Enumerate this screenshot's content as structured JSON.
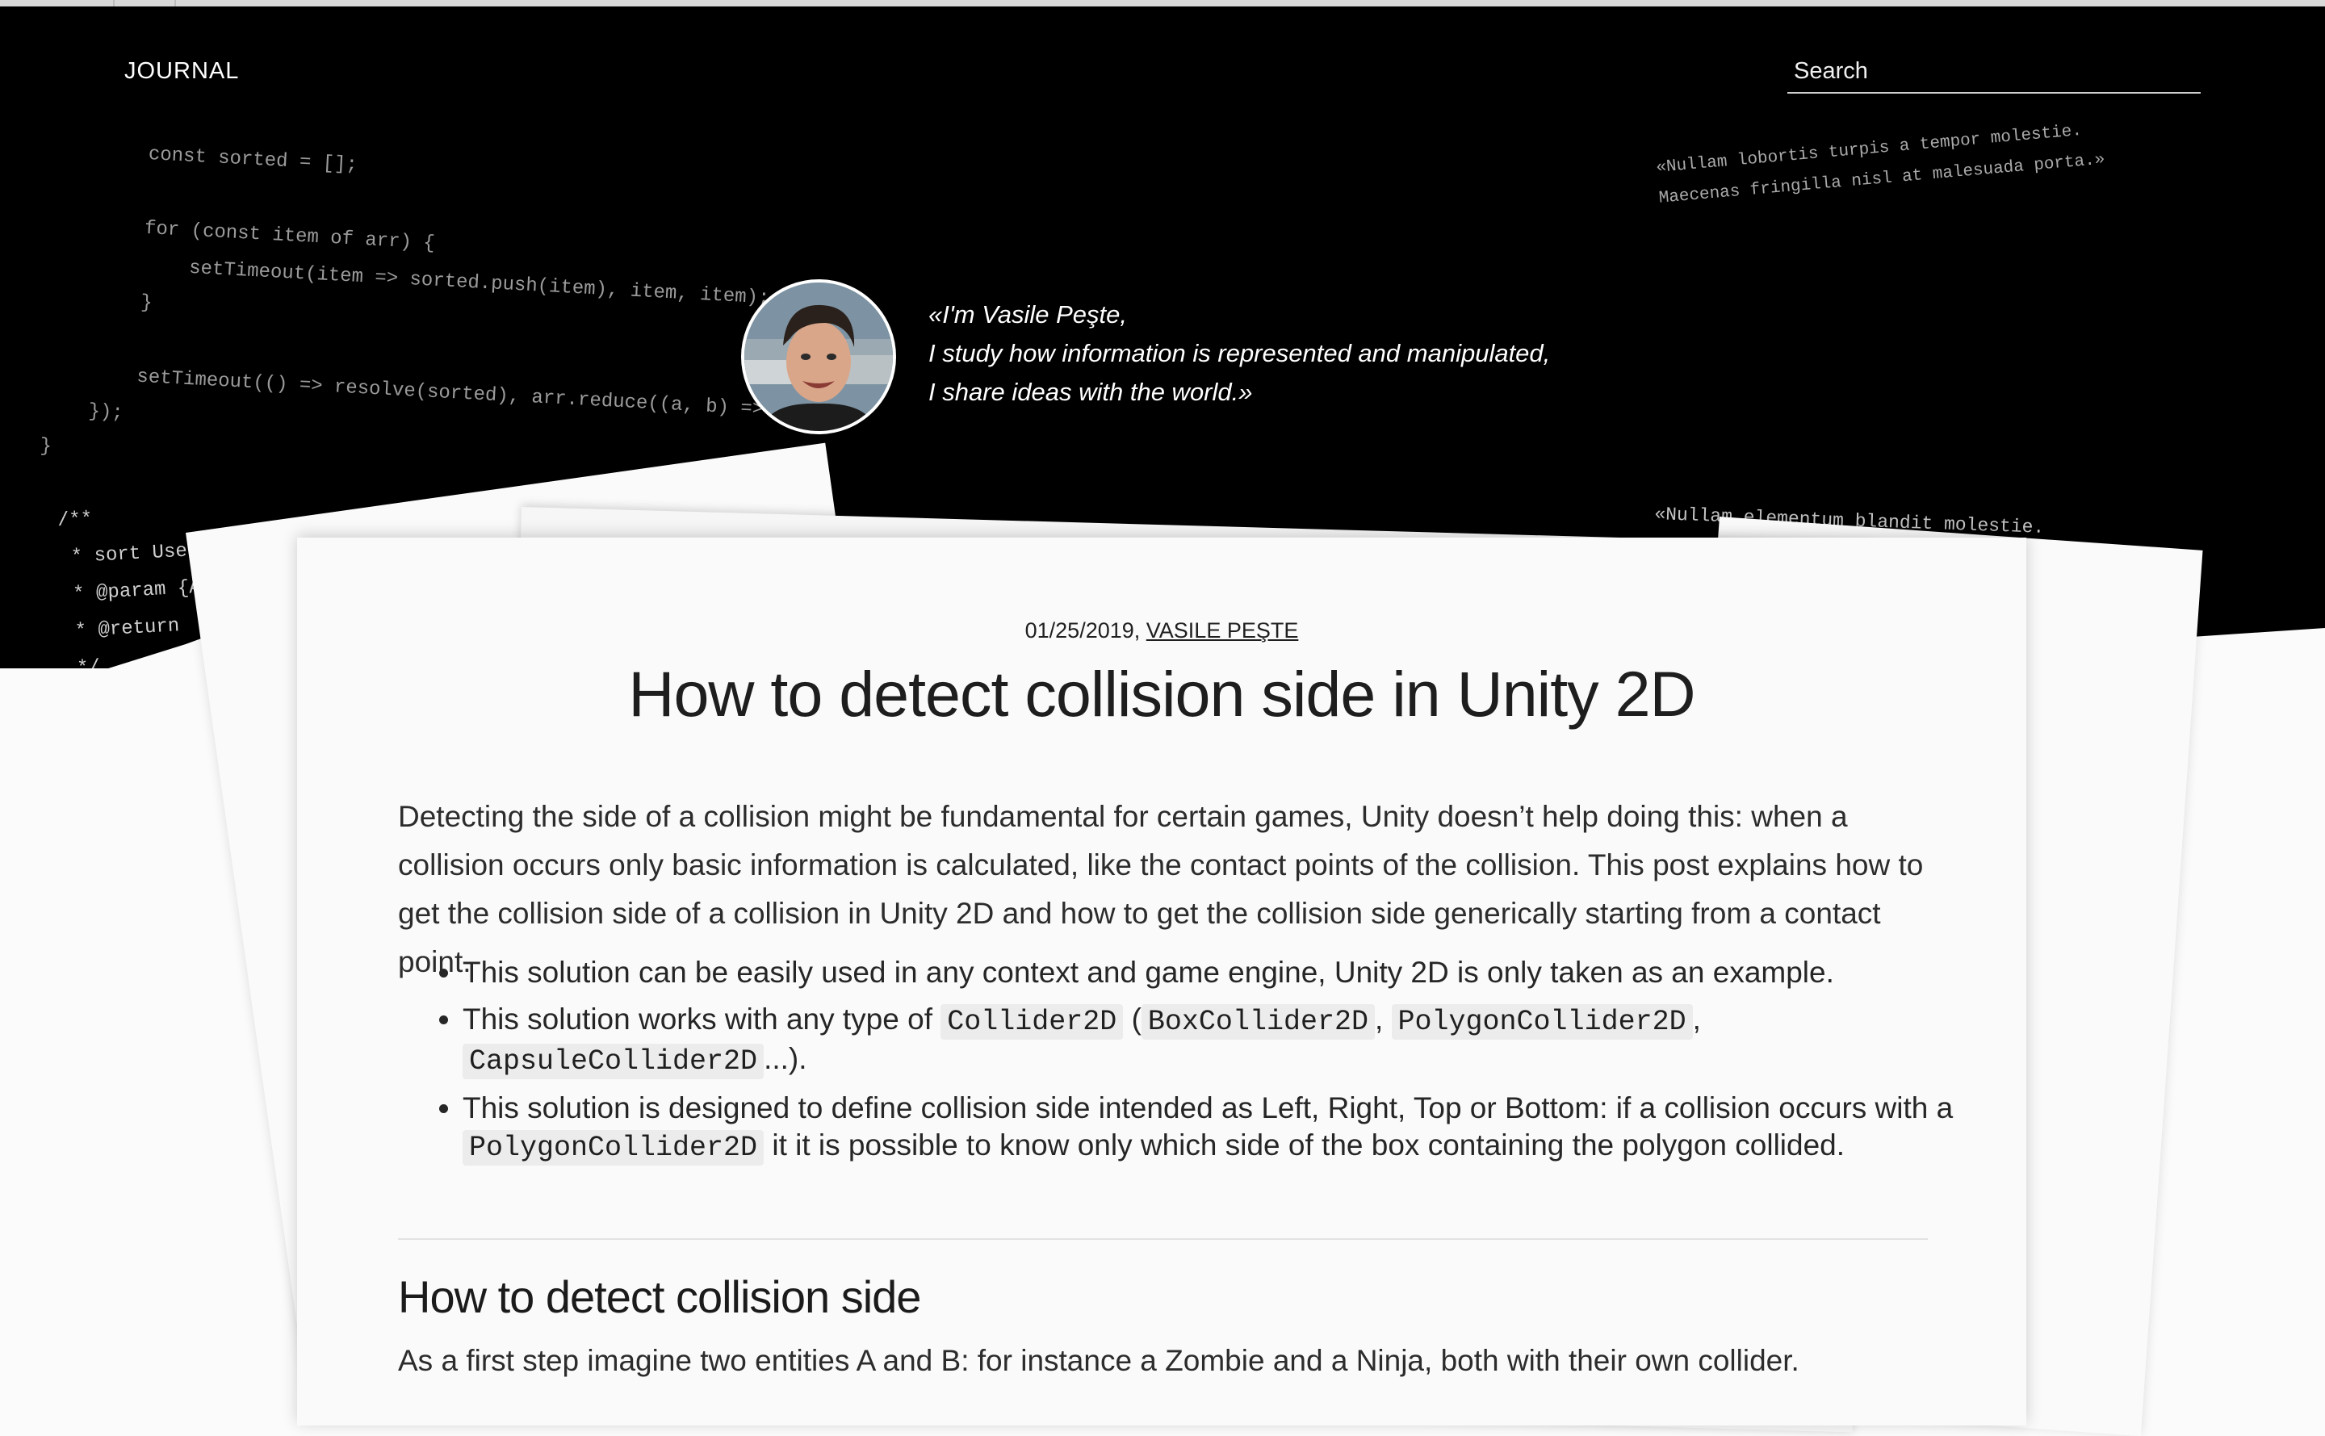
{
  "header": {
    "brand": "JOURNAL",
    "search_placeholder": "Search"
  },
  "hero": {
    "quote_lines": [
      "«I'm Vasile Peşte,",
      "I study how information is represented and manipulated,",
      "I share ideas with the world.»"
    ],
    "code_snippets": {
      "top_left": "        const sorted = [];\n\n        for (const item of arr) {\n            setTimeout(item => sorted.push(item), item, item);\n        }\n\n        setTimeout(() => resolve(sorted), arr.reduce((a, b) =>\n    });\n}",
      "bottom_left": "/**\n * sort Used to order an array of integers in O(n).\n * @param {Array}\n * @return\n */\n\nfunction",
      "top_right": "«Nullam lobortis turpis a tempor molestie.\nMaecenas fringilla nisl at malesuada porta.»",
      "bottom_right": "«Nullam elementum blandit molestie.\n                                        s.\n                                  t dolor.»"
    }
  },
  "article": {
    "date": "01/25/2019,",
    "author": "VASILE PEŞTE",
    "title": "How to detect collision side in Unity 2D",
    "intro": "Detecting the side of a collision might be fundamental for certain games, Unity doesn’t help doing this: when a collision occurs only basic information is calculated, like the contact points of the collision. This post explains how to get the collision side of a collision in Unity 2D and how to get the collision side generically starting from a contact point.",
    "bullet1": "This solution can be easily used in any context and game engine, Unity 2D is only taken as an example.",
    "bullet2": {
      "prefix": "This solution works with any type of",
      "code1": "Collider2D",
      "open": "(",
      "code2": "BoxCollider2D",
      "comma": ",",
      "code3": "PolygonCollider2D",
      "comma2": ",",
      "code4": "CapsuleCollider2D",
      "suffix": "...)."
    },
    "bullet3": {
      "prefix": "This solution is designed to define collision side intended as Left, Right, Top or Bottom: if a collision occurs with a",
      "code": "PolygonCollider2D",
      "suffix": "it it is possible to know only which side of the box containing the polygon collided."
    },
    "section_heading": "How to detect collision side",
    "next_paragraph": "As a first step imagine two entities A and B: for instance a Zombie and a Ninja, both with their own collider."
  }
}
